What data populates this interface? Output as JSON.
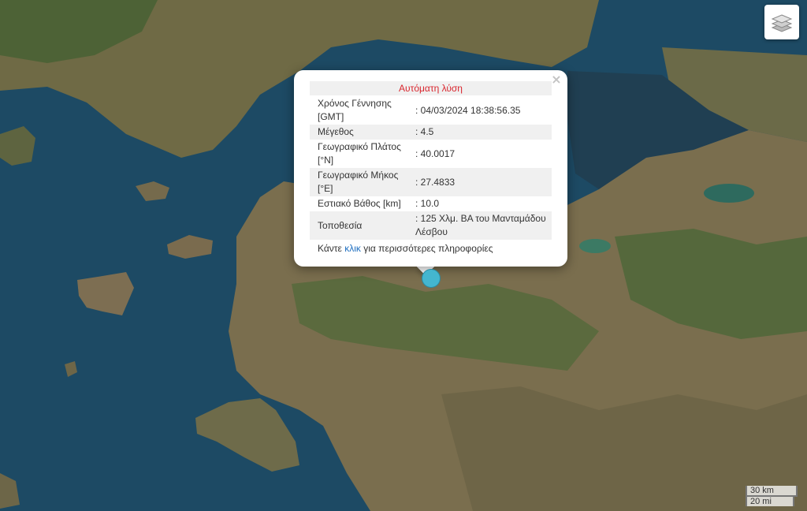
{
  "map": {
    "basemap": "satellite-imagery"
  },
  "controls": {
    "layers_icon": "layers-icon"
  },
  "popup": {
    "title": "Αυτόματη λύση",
    "rows": [
      {
        "key": "Χρόνος Γέννησης [GMT]",
        "value": ": 04/03/2024 18:38:56.35"
      },
      {
        "key": "Μέγεθος",
        "value": ": 4.5"
      },
      {
        "key": "Γεωγραφικό Πλάτος [°N]",
        "value": ": 40.0017"
      },
      {
        "key": "Γεωγραφικό Μήκος [°E]",
        "value": ": 27.4833"
      },
      {
        "key": "Εστιακό Βάθος [km]",
        "value": ": 10.0"
      },
      {
        "key": "Τοποθεσία",
        "value": ": 125 Χλμ. ΒΑ του Μανταμάδου Λέσβου"
      }
    ],
    "more_prefix": "Κάντε ",
    "more_link": "κλικ",
    "more_suffix": " για περισσότερες πληροφορίες",
    "close_symbol": "×"
  },
  "marker": {
    "color": "#44b6cf"
  },
  "scale": {
    "metric": "30 km",
    "imperial": "20 mi"
  }
}
